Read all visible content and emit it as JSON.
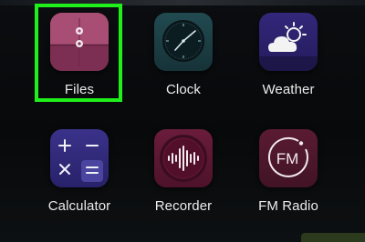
{
  "apps": [
    {
      "name": "files",
      "label": "Files",
      "icon": "folder-icon",
      "color": "#8e3a5e",
      "highlighted": true
    },
    {
      "name": "clock",
      "label": "Clock",
      "icon": "clock-icon",
      "color": "#1c3e43"
    },
    {
      "name": "weather",
      "label": "Weather",
      "icon": "weather-icon",
      "color": "#2a1f66"
    },
    {
      "name": "calculator",
      "label": "Calculator",
      "icon": "calculator-icon",
      "color": "#2f2a6e"
    },
    {
      "name": "recorder",
      "label": "Recorder",
      "icon": "recorder-icon",
      "color": "#5b1732"
    },
    {
      "name": "fm-radio",
      "label": "FM Radio",
      "icon": "radio-icon",
      "color": "#4a1628"
    }
  ],
  "fm_icon_text": "FM",
  "highlight_color": "#1ff01c"
}
